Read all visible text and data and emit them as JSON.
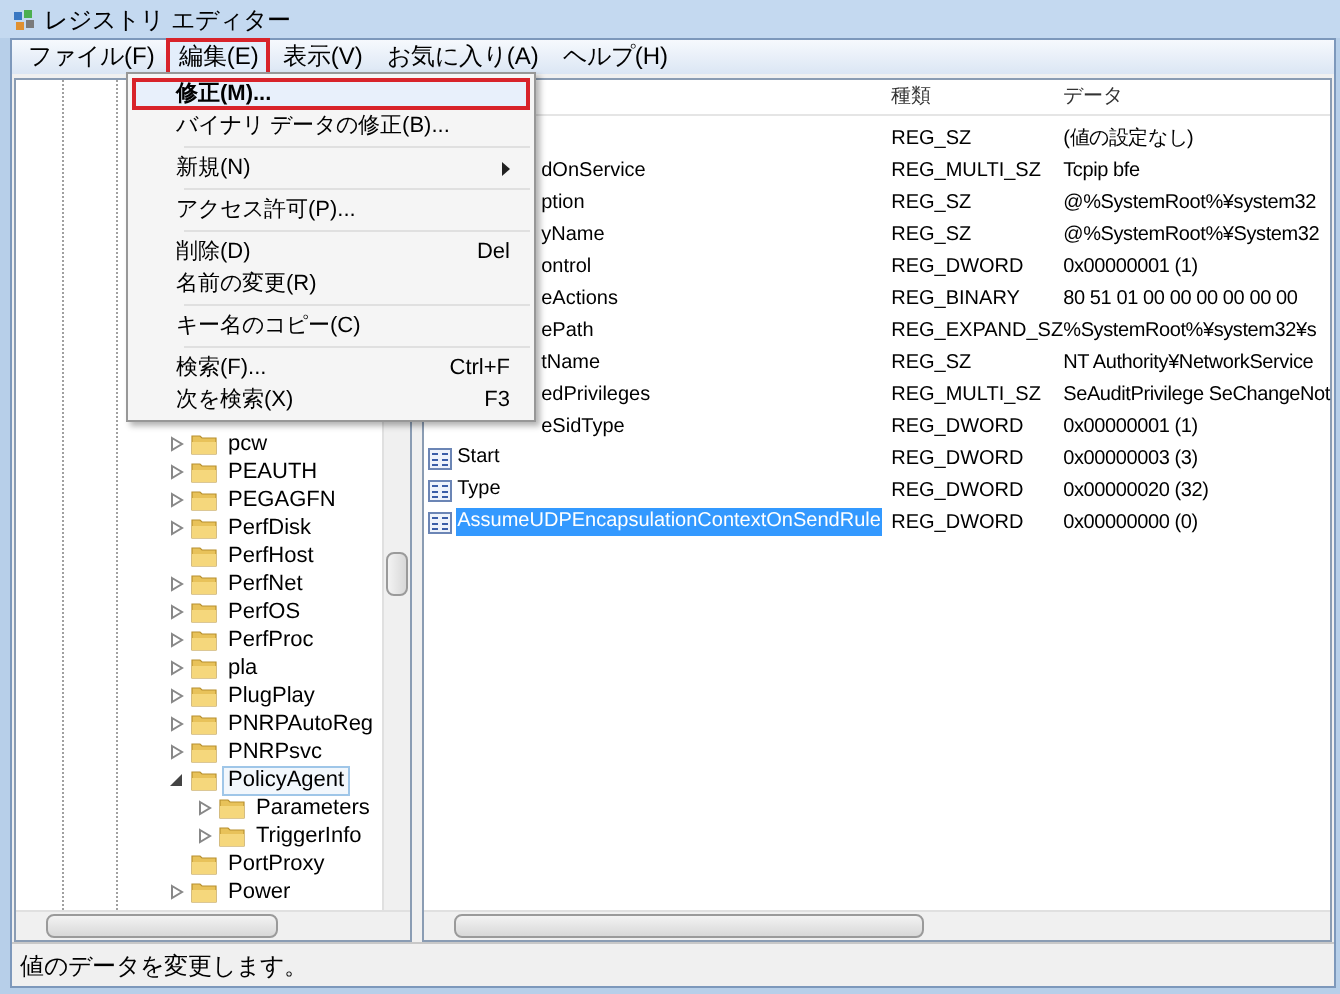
{
  "window": {
    "title": "レジストリ エディター"
  },
  "menu_bar": [
    {
      "label": "ファイル(F)",
      "selected": false
    },
    {
      "label": "編集(E)",
      "selected": true
    },
    {
      "label": "表示(V)",
      "selected": false
    },
    {
      "label": "お気に入り(A)",
      "selected": false
    },
    {
      "label": "ヘルプ(H)",
      "selected": false
    }
  ],
  "edit_menu": [
    {
      "kind": "item",
      "label": "修正(M)...",
      "selected": true
    },
    {
      "kind": "item",
      "label": "バイナリ データの修正(B)...",
      "selected": false
    },
    {
      "kind": "separator"
    },
    {
      "kind": "submenu",
      "label": "新規(N)",
      "selected": false
    },
    {
      "kind": "separator"
    },
    {
      "kind": "item",
      "label": "アクセス許可(P)...",
      "selected": false
    },
    {
      "kind": "separator"
    },
    {
      "kind": "item",
      "label": "削除(D)",
      "shortcut": "Del",
      "selected": false
    },
    {
      "kind": "item",
      "label": "名前の変更(R)",
      "selected": false
    },
    {
      "kind": "separator"
    },
    {
      "kind": "item",
      "label": "キー名のコピー(C)",
      "selected": false
    },
    {
      "kind": "separator"
    },
    {
      "kind": "item",
      "label": "検索(F)...",
      "shortcut": "Ctrl+F",
      "selected": false
    },
    {
      "kind": "item",
      "label": "次を検索(X)",
      "shortcut": "F3",
      "selected": false
    }
  ],
  "tree": [
    {
      "label": "pcw",
      "has_children": true,
      "expanded": false,
      "selected": false
    },
    {
      "label": "PEAUTH",
      "has_children": true,
      "expanded": false,
      "selected": false
    },
    {
      "label": "PEGAGFN",
      "has_children": true,
      "expanded": false,
      "selected": false
    },
    {
      "label": "PerfDisk",
      "has_children": true,
      "expanded": false,
      "selected": false
    },
    {
      "label": "PerfHost",
      "has_children": false,
      "selected": false
    },
    {
      "label": "PerfNet",
      "has_children": true,
      "expanded": false,
      "selected": false
    },
    {
      "label": "PerfOS",
      "has_children": true,
      "expanded": false,
      "selected": false
    },
    {
      "label": "PerfProc",
      "has_children": true,
      "expanded": false,
      "selected": false
    },
    {
      "label": "pla",
      "has_children": true,
      "expanded": false,
      "selected": false
    },
    {
      "label": "PlugPlay",
      "has_children": true,
      "expanded": false,
      "selected": false
    },
    {
      "label": "PNRPAutoReg",
      "has_children": true,
      "expanded": false,
      "selected": false
    },
    {
      "label": "PNRPsvc",
      "has_children": true,
      "expanded": false,
      "selected": false
    },
    {
      "label": "PolicyAgent",
      "has_children": true,
      "expanded": true,
      "selected": true,
      "children": [
        {
          "label": "Parameters",
          "has_children": true,
          "expanded": false,
          "selected": false
        },
        {
          "label": "TriggerInfo",
          "has_children": true,
          "expanded": false,
          "selected": false
        }
      ]
    },
    {
      "label": "PortProxy",
      "has_children": false,
      "selected": false
    },
    {
      "label": "Power",
      "has_children": true,
      "expanded": false,
      "selected": false
    }
  ],
  "values": {
    "columns": [
      "種類",
      "データ"
    ],
    "rows": [
      {
        "kind": "covered",
        "type": "REG_SZ",
        "data": "(値の設定なし)",
        "selected": false
      },
      {
        "kind": "covered",
        "name": "dOnService",
        "type": "REG_MULTI_SZ",
        "data": "Tcpip bfe",
        "selected": false
      },
      {
        "kind": "covered",
        "name": "ption",
        "type": "REG_SZ",
        "data": "@%SystemRoot%¥system32",
        "selected": false
      },
      {
        "kind": "covered",
        "name": "yName",
        "type": "REG_SZ",
        "data": "@%SystemRoot%¥System32",
        "selected": false
      },
      {
        "kind": "covered",
        "name": "ontrol",
        "type": "REG_DWORD",
        "data": "0x00000001 (1)",
        "selected": false
      },
      {
        "kind": "covered",
        "name": "eActions",
        "type": "REG_BINARY",
        "data": "80 51 01 00 00 00 00 00 00",
        "selected": false
      },
      {
        "kind": "covered",
        "name": "ePath",
        "type": "REG_EXPAND_SZ",
        "data": "%SystemRoot%¥system32¥s",
        "selected": false
      },
      {
        "kind": "covered",
        "name": "tName",
        "type": "REG_SZ",
        "data": "NT Authority¥NetworkService",
        "selected": false
      },
      {
        "kind": "covered",
        "name": "edPrivileges",
        "type": "REG_MULTI_SZ",
        "data": "SeAuditPrivilege SeChangeNot",
        "selected": false
      },
      {
        "kind": "covered",
        "name": "eSidType",
        "type": "REG_DWORD",
        "data": "0x00000001 (1)",
        "selected": false
      },
      {
        "kind": "value",
        "name": "Start",
        "type": "REG_DWORD",
        "data": "0x00000003 (3)",
        "selected": false
      },
      {
        "kind": "value",
        "name": "Type",
        "type": "REG_DWORD",
        "data": "0x00000020 (32)",
        "selected": false
      },
      {
        "kind": "value",
        "name": "AssumeUDPEncapsulationContextOnSendRule",
        "type": "REG_DWORD",
        "data": "0x00000000 (0)",
        "selected": true
      }
    ]
  },
  "status_bar": {
    "text": "値のデータを変更します。"
  }
}
